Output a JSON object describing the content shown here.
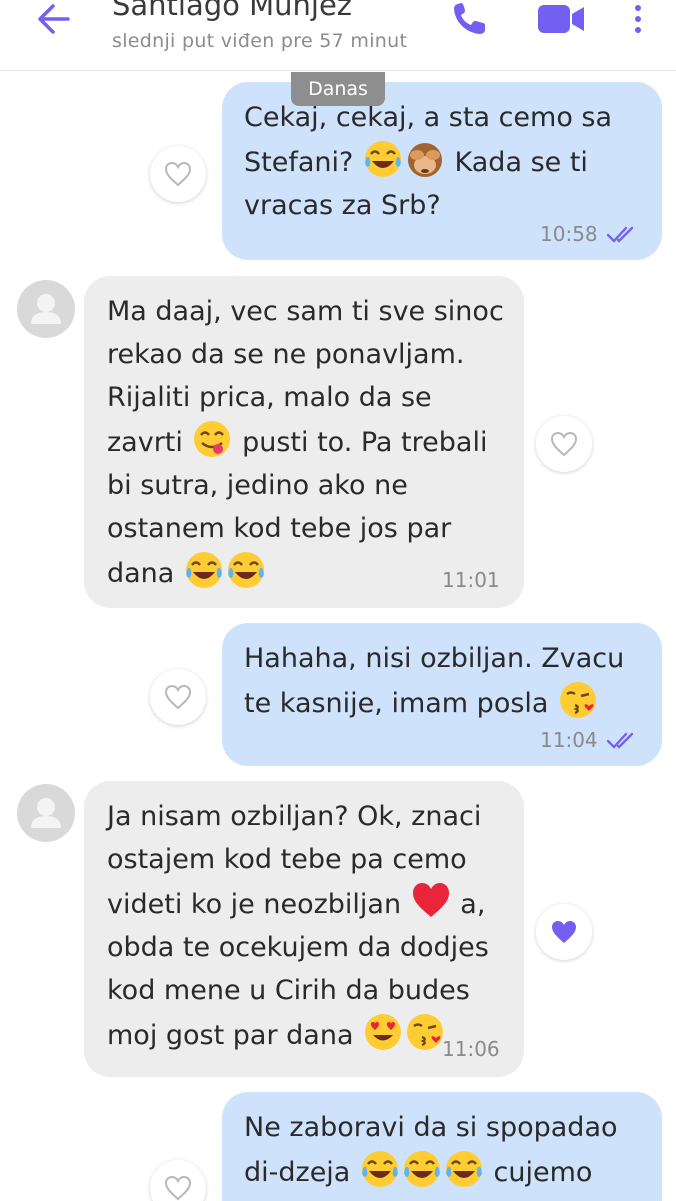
{
  "header": {
    "contact_name": "Santiago Munjez",
    "last_seen": "slednji put viđen pre 57 minut",
    "back_icon": "arrow-left-icon",
    "call_icon": "phone-icon",
    "video_icon": "video-camera-icon",
    "more_icon": "more-vertical-icon"
  },
  "day_separator": "Danas",
  "colors": {
    "accent": "#7360f2",
    "outgoing_bubble": "#cfe2fb",
    "incoming_bubble": "#ededed"
  },
  "messages": [
    {
      "direction": "outgoing",
      "line1": "Cekaj, cekaj, a sta cemo sa",
      "line2a": "Stefani?",
      "line2b": "Kada se ti",
      "line3": "vracas za Srb?",
      "time": "10:58",
      "status": "seen"
    },
    {
      "direction": "incoming",
      "line1": "Ma daaj, vec sam ti sve sinoc",
      "line2": "rekao da se ne ponavljam.",
      "line3": "Rijaliti prica, malo da se",
      "line4a": "zavrti",
      "line4b": "pusti to. Pa trebali",
      "line5": "bi sutra, jedino ako ne",
      "line6": "ostanem kod tebe jos par",
      "line7": "dana",
      "time": "11:01",
      "liked": false
    },
    {
      "direction": "outgoing",
      "line1": "Hahaha, nisi ozbiljan. Zvacu",
      "line2": "te kasnije, imam posla",
      "time": "11:04",
      "status": "seen"
    },
    {
      "direction": "incoming",
      "line1": "Ja nisam ozbiljan? Ok, znaci",
      "line2": "ostajem kod tebe pa cemo",
      "line3a": "videti ko je neozbiljan",
      "line3b": "a,",
      "line4": "obda te ocekujem da dodjes",
      "line5": "kod mene u Cirih da budes",
      "line6": "moj gost par dana",
      "time": "11:06",
      "liked": true
    },
    {
      "direction": "outgoing",
      "line1": "Ne zaboravi da si spopadao",
      "line2a": "di-dzeja",
      "line2b": "cujemo"
    }
  ]
}
